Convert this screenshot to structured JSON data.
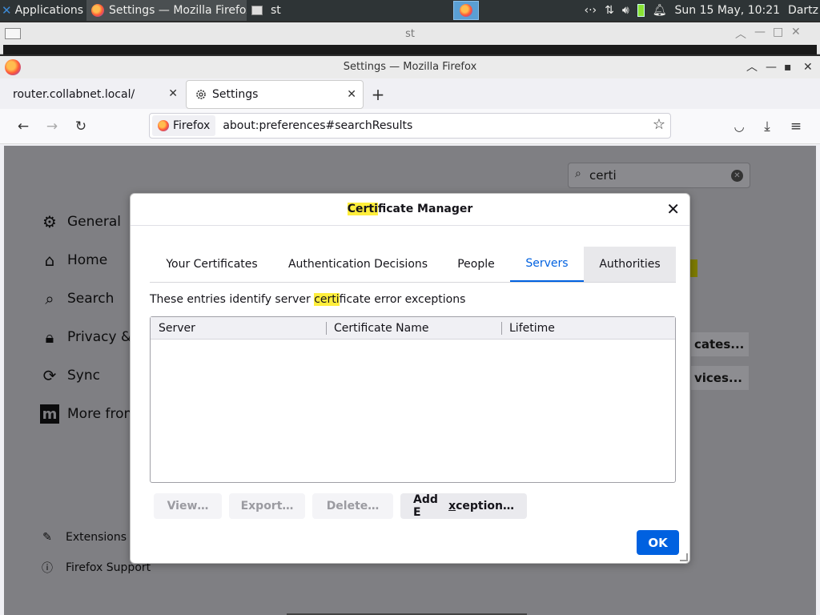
{
  "panel": {
    "applications_label": "Applications",
    "task_firefox": "Settings — Mozilla Firefox",
    "task_terminal": "st",
    "clock": "Sun 15 May, 10:21",
    "user": "Dartz"
  },
  "terminal_window": {
    "title": "st"
  },
  "firefox": {
    "window_title": "Settings — Mozilla Firefox",
    "tabs": [
      {
        "label": "router.collabnet.local/"
      },
      {
        "label": "Settings"
      }
    ],
    "identity_label": "Firefox",
    "url": "about:preferences#searchResults"
  },
  "settings": {
    "search_value": "certi",
    "categories": [
      {
        "label": "General",
        "icon": "gear-icon"
      },
      {
        "label": "Home",
        "icon": "home-icon"
      },
      {
        "label": "Search",
        "icon": "search-icon"
      },
      {
        "label": "Privacy &",
        "icon": "lock-icon"
      },
      {
        "label": "Sync",
        "icon": "sync-icon"
      },
      {
        "label": "More from",
        "icon": "mozilla-icon"
      }
    ],
    "footer": [
      {
        "label": "Extensions &",
        "icon": "puzzle-icon"
      },
      {
        "label": "Firefox Support",
        "icon": "help-icon"
      }
    ],
    "bg_buttons": [
      "cates...",
      "vices..."
    ]
  },
  "dialog": {
    "title_mark": "Certi",
    "title_rest": "ficate Manager",
    "tabs": [
      {
        "label": "Your Certificates"
      },
      {
        "label": "Authentication Decisions"
      },
      {
        "label": "People"
      },
      {
        "label": "Servers"
      },
      {
        "label": "Authorities"
      }
    ],
    "selected_tab": "Servers",
    "desc_pre": "These entries identify server ",
    "desc_mark": "certi",
    "desc_post": "ficate error exceptions",
    "columns": [
      "Server",
      "Certificate Name",
      "Lifetime"
    ],
    "rows": [],
    "buttons": {
      "view": {
        "label": "View…",
        "enabled": false
      },
      "export": {
        "label": "Export…",
        "enabled": false
      },
      "delete": {
        "label": "Delete…",
        "enabled": false
      },
      "add_exception_pre": "Add E",
      "add_exception_key": "x",
      "add_exception_post": "ception…",
      "ok": "OK"
    }
  },
  "colors": {
    "accent": "#0061e0",
    "highlight": "#ffee3c"
  }
}
